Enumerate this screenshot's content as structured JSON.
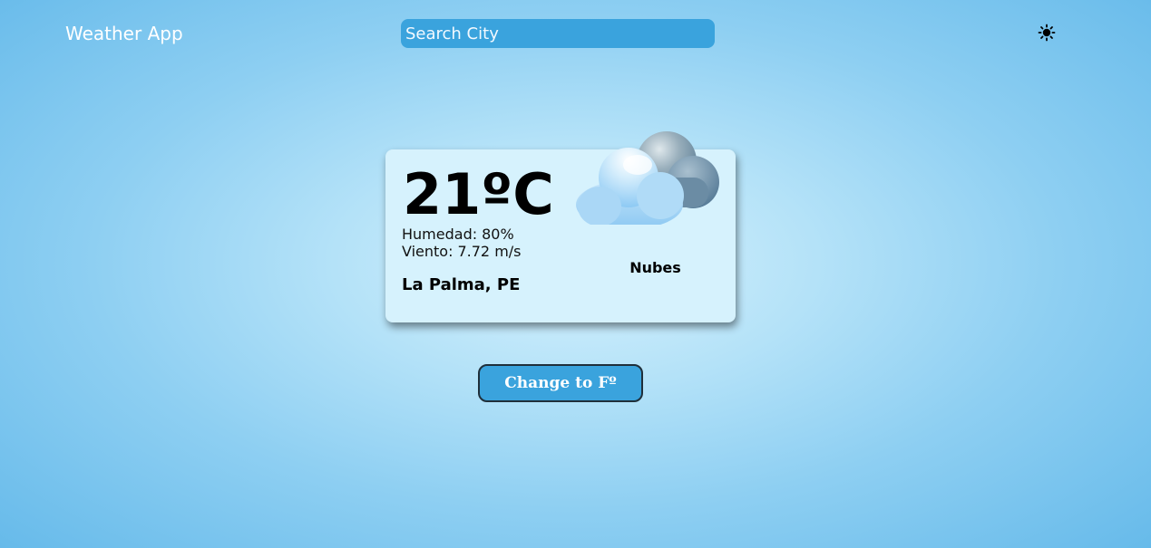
{
  "header": {
    "title": "Weather App",
    "search": {
      "placeholder": "Search City",
      "value": ""
    },
    "theme_toggle_icon": "sun-icon"
  },
  "weather": {
    "temperature": "21ºC",
    "humidity_label": "Humedad:",
    "humidity_value": "80%",
    "wind_label": "Viento:",
    "wind_value": "7.72 m/s",
    "location": "La Palma, PE",
    "description": "Nubes",
    "icon": "clouds-icon"
  },
  "actions": {
    "unit_toggle_label": "Change to Fº"
  },
  "colors": {
    "accent": "#3aa3dd",
    "card_background": "#d6f2fd",
    "title_text": "#ffffff"
  }
}
